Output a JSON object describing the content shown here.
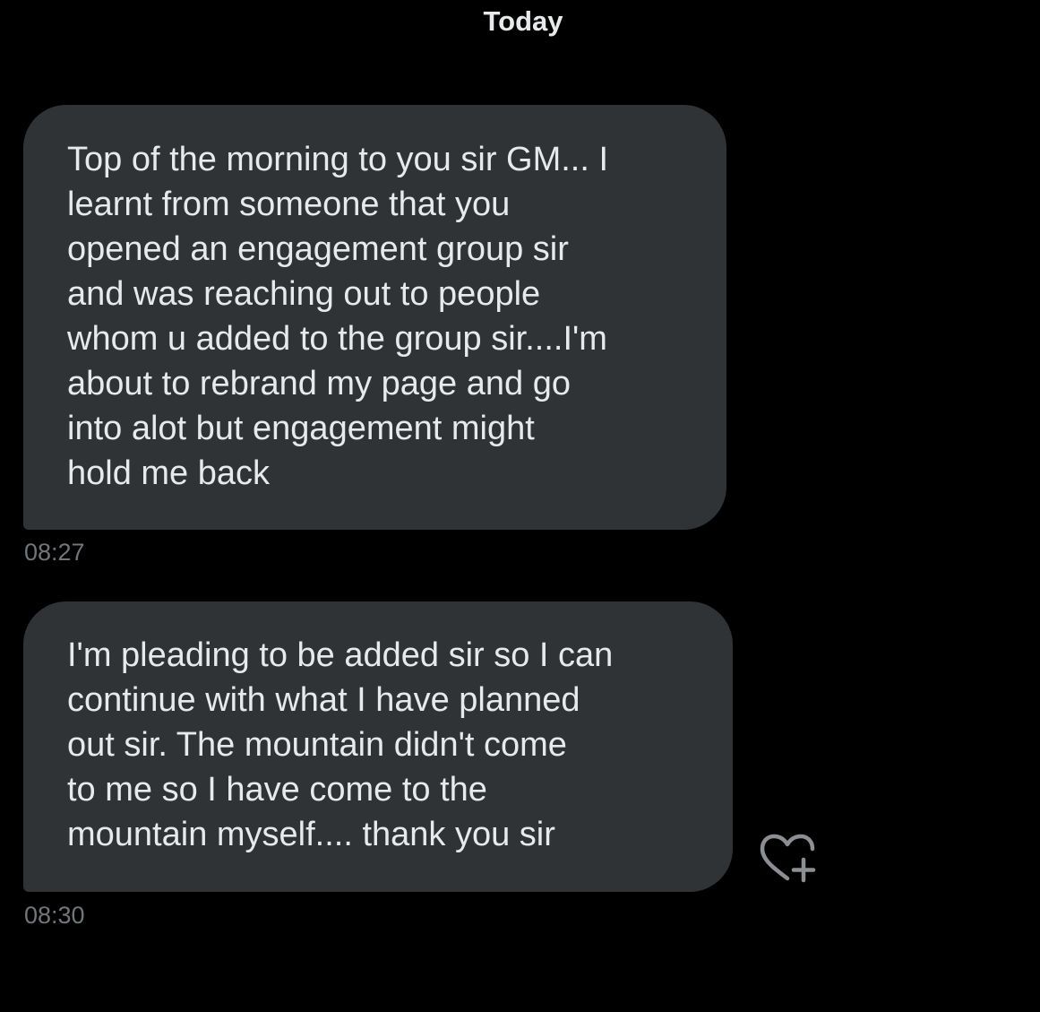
{
  "conversation": {
    "day_label": "Today",
    "messages": [
      {
        "text": "Top of the morning to you sir GM... I\nlearnt from someone that you\nopened an engagement group sir\nand was reaching out to people\nwhom u added to the group sir....I'm\nabout to rebrand my page and go\ninto alot but engagement might\nhold me back",
        "time": "08:27"
      },
      {
        "text": "I'm pleading to be added sir so I can\ncontinue with what I have planned\nout sir. The mountain didn't come\nto me so I have come to the\nmountain myself.... thank you sir",
        "time": "08:30"
      }
    ],
    "reaction_icon": "heart-plus-icon"
  },
  "colors": {
    "background": "#000000",
    "bubble": "#2f3336",
    "text": "#e7e9ea",
    "timestamp": "#71767b"
  }
}
